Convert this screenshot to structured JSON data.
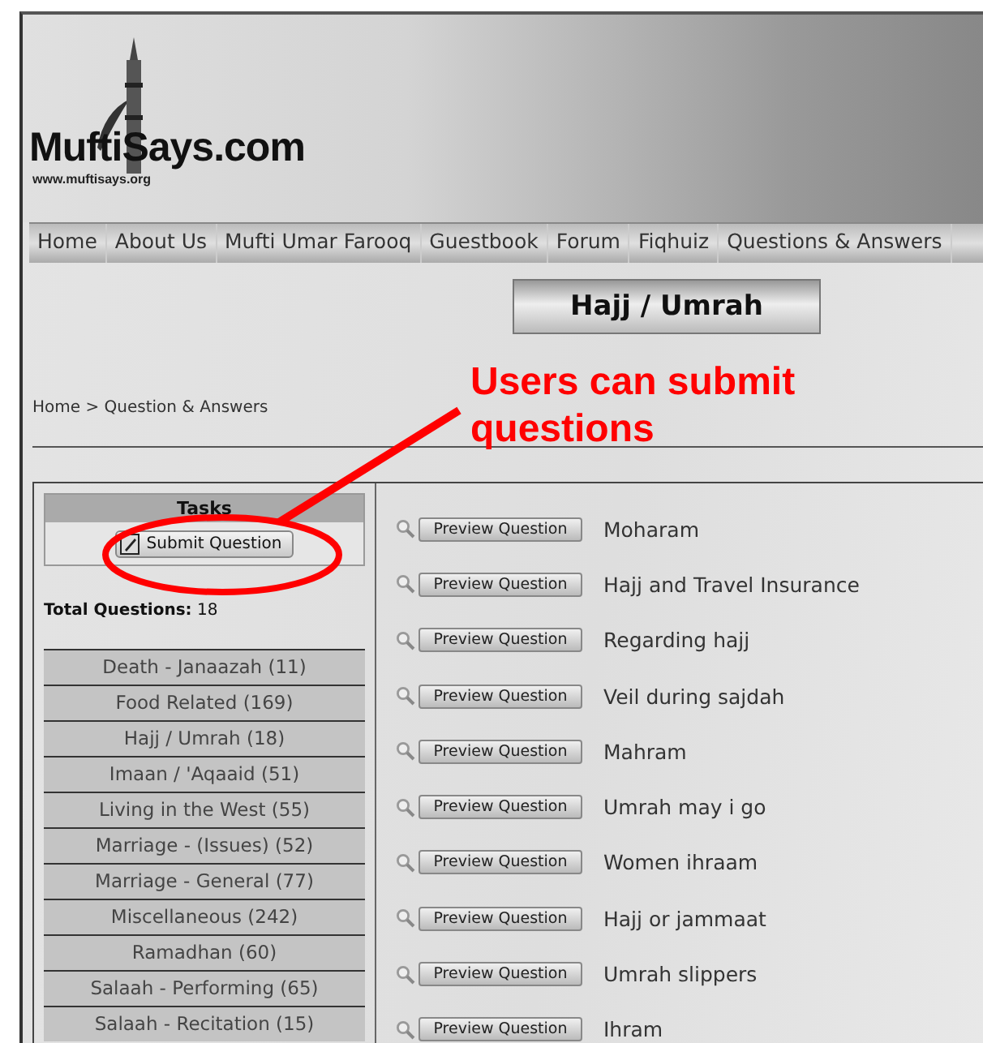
{
  "logo": {
    "name": "MuftiSays.com",
    "url": "www.muftisays.org"
  },
  "nav": [
    "Home",
    "About Us",
    "Mufti Umar Farooq",
    "Guestbook",
    "Forum",
    "Fiqhuiz",
    "Questions & Answers"
  ],
  "page_title": "Hajj / Umrah",
  "breadcrumb": "Home > Question & Answers",
  "annotation": "Users can submit questions",
  "tasks": {
    "title": "Tasks",
    "button": "Submit Question"
  },
  "total": {
    "label": "Total Questions:",
    "value": "18"
  },
  "categories": [
    {
      "label": "Death - Janaazah (11)"
    },
    {
      "label": "Food Related (169)"
    },
    {
      "label": "Hajj / Umrah (18)"
    },
    {
      "label": "Imaan / 'Aqaaid (51)"
    },
    {
      "label": "Living in the West (55)"
    },
    {
      "label": "Marriage - (Issues) (52)"
    },
    {
      "label": "Marriage - General (77)"
    },
    {
      "label": "Miscellaneous (242)"
    },
    {
      "label": "Ramadhan (60)"
    },
    {
      "label": "Salaah - Performing (65)"
    },
    {
      "label": "Salaah - Recitation (15)"
    }
  ],
  "questions": [
    {
      "button": "Preview Question",
      "title": "Moharam"
    },
    {
      "button": "Preview Question",
      "title": "Hajj and Travel Insurance"
    },
    {
      "button": "Preview Question",
      "title": "Regarding hajj"
    },
    {
      "button": "Preview Question",
      "title": "Veil during sajdah"
    },
    {
      "button": "Preview Question",
      "title": "Mahram"
    },
    {
      "button": "Preview Question",
      "title": "Umrah may i go"
    },
    {
      "button": "Preview Question",
      "title": "Women ihraam"
    },
    {
      "button": "Preview Question",
      "title": "Hajj or jammaat"
    },
    {
      "button": "Preview Question",
      "title": "Umrah slippers"
    },
    {
      "button": "Preview Question",
      "title": "Ihram"
    }
  ]
}
